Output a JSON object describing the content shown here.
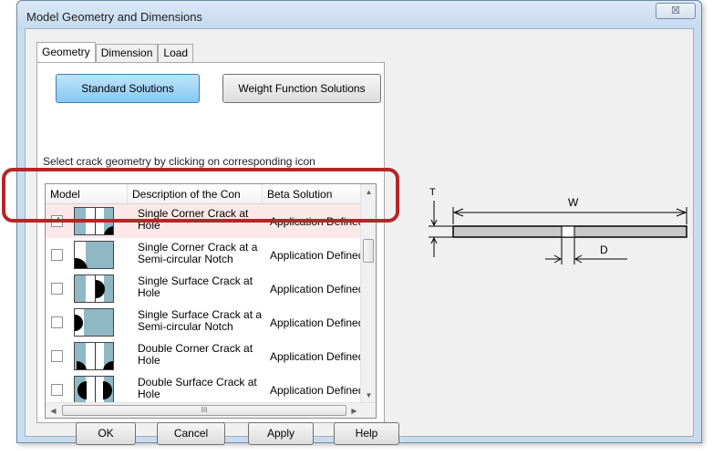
{
  "window": {
    "title": "Model Geometry and Dimensions",
    "close_glyph": "☒"
  },
  "tabs": [
    {
      "label": "Geometry",
      "active": true
    },
    {
      "label": "Dimension",
      "active": false
    },
    {
      "label": "Load",
      "active": false
    }
  ],
  "solution_buttons": {
    "standard": "Standard Solutions",
    "weight_function": "Weight Function Solutions"
  },
  "instruction": "Select  crack geometry by clicking  on corresponding icon",
  "table": {
    "columns": [
      "Model",
      "Description of the Con",
      "Beta Solution"
    ],
    "rows": [
      {
        "checked": true,
        "description": "Single Corner Crack at Hole",
        "beta": "Application Defined",
        "icon": "corner-crack-at-hole-icon"
      },
      {
        "checked": false,
        "description": "Single Corner Crack at a Semi-circular Notch",
        "beta": "Application Defined",
        "icon": "corner-crack-semicircular-notch-icon"
      },
      {
        "checked": false,
        "description": "Single Surface Crack at Hole",
        "beta": "Application Defined",
        "icon": "surface-crack-at-hole-icon"
      },
      {
        "checked": false,
        "description": "Single Surface Crack at a Semi-circular Notch",
        "beta": "Application Defined",
        "icon": "surface-crack-semicircular-notch-icon"
      },
      {
        "checked": false,
        "description": "Double Corner Crack at Hole",
        "beta": "Application Defined",
        "icon": "double-corner-crack-at-hole-icon"
      },
      {
        "checked": false,
        "description": "Double Surface Crack at Hole",
        "beta": "Application Defined",
        "icon": "double-surface-crack-at-hole-icon"
      }
    ],
    "hscroll_grip": "III"
  },
  "diagram": {
    "labels": {
      "thickness": "T",
      "width": "W",
      "diameter": "D"
    }
  },
  "footer_buttons": {
    "ok": "OK",
    "cancel": "Cancel",
    "apply": "Apply",
    "help": "Help"
  },
  "colors": {
    "selected_button": "#86c8f1",
    "highlight_outline": "#b52626",
    "thumbnail_fill": "#8fb8c4"
  }
}
